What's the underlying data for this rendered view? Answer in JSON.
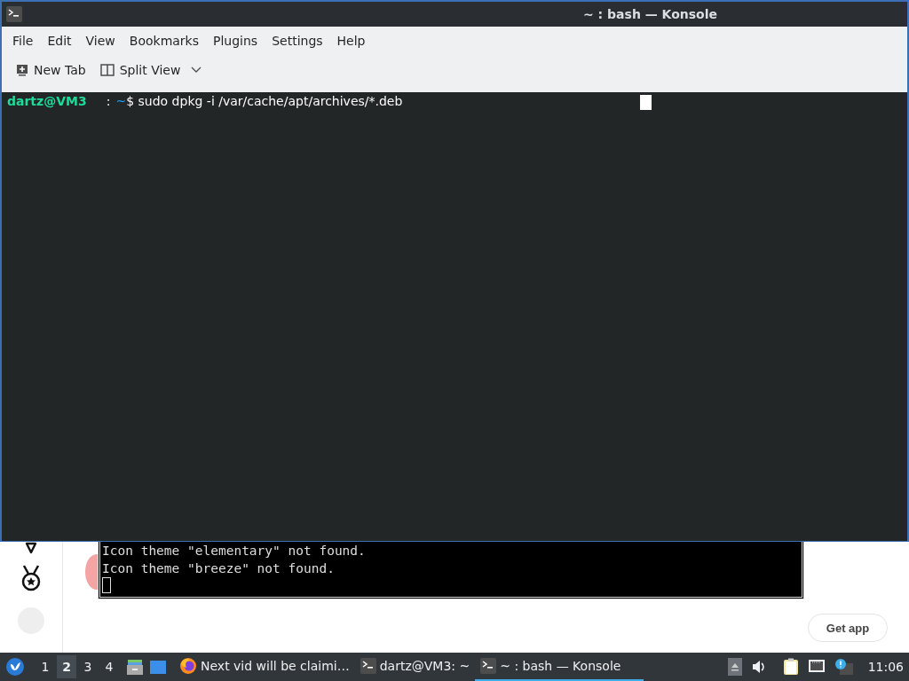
{
  "window": {
    "title": "~ : bash — Konsole"
  },
  "menu": [
    "File",
    "Edit",
    "View",
    "Bookmarks",
    "Plugins",
    "Settings",
    "Help"
  ],
  "toolbar": [
    {
      "kind": "new-tab",
      "label": "New Tab"
    },
    {
      "kind": "split-view",
      "label": "Split View"
    }
  ],
  "terminal": {
    "user": "dartz@VM3",
    "separator": ":",
    "path": "~",
    "command": "$ sudo dpkg -i /var/cache/apt/archives/*.deb"
  },
  "background_page": {
    "console_lines": [
      "Icon theme \"elementary\" not found.",
      "Icon theme \"breeze\" not found."
    ],
    "get_app_button": "Get app"
  },
  "taskbar": {
    "desktops": [
      {
        "label": "1",
        "selected": false
      },
      {
        "label": "2",
        "selected": true
      },
      {
        "label": "3",
        "selected": false
      },
      {
        "label": "4",
        "selected": false
      }
    ],
    "tasks": [
      {
        "kind": "firefox",
        "label": "Next vid will be claimi…",
        "selected": false
      },
      {
        "kind": "terminal",
        "label": "dartz@VM3: ~",
        "selected": false
      },
      {
        "kind": "terminal",
        "label": "~ : bash — Konsole",
        "selected": true
      }
    ],
    "clock": "11:06"
  }
}
